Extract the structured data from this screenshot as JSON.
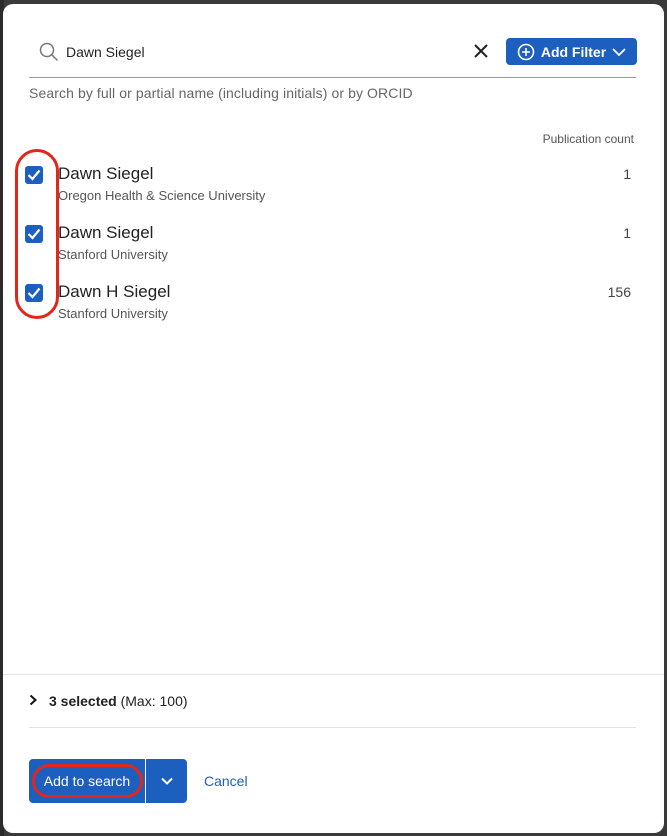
{
  "search": {
    "value": "Dawn Siegel",
    "hint": "Search by full or partial name (including initials) or by ORCID",
    "add_filter_label": "Add Filter"
  },
  "results_header": {
    "count_column": "Publication count"
  },
  "results": [
    {
      "name": "Dawn Siegel",
      "org": "Oregon Health & Science University",
      "count": "1",
      "checked": true
    },
    {
      "name": "Dawn Siegel",
      "org": "Stanford University",
      "count": "1",
      "checked": true
    },
    {
      "name": "Dawn H Siegel",
      "org": "Stanford University",
      "count": "156",
      "checked": true
    }
  ],
  "footer": {
    "selected_count": "3 selected",
    "selected_max": "(Max: 100)",
    "add_to_search_label": "Add to search",
    "cancel_label": "Cancel"
  },
  "colors": {
    "accent": "#1d5fbf",
    "highlight": "#e2261a"
  }
}
